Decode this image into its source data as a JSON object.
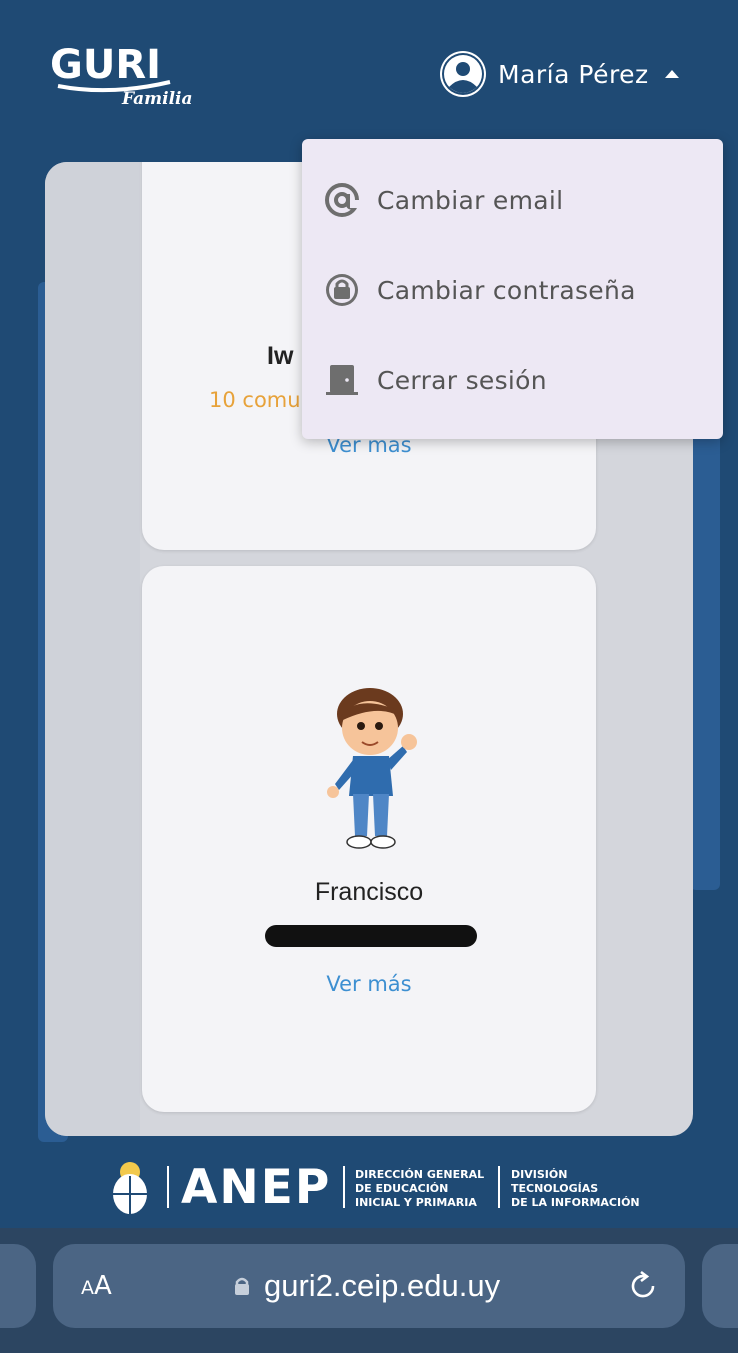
{
  "header": {
    "logo_text": "GURI",
    "logo_sub": "Familia",
    "user_name": "María Pérez"
  },
  "menu": {
    "items": [
      {
        "label": "Cambiar email",
        "icon": "at-icon"
      },
      {
        "label": "Cambiar contraseña",
        "icon": "lock-icon"
      },
      {
        "label": "Cerrar sesión",
        "icon": "door-icon"
      }
    ]
  },
  "cards": [
    {
      "name": "Iw",
      "communications": "10 comu",
      "link": "Ver más"
    },
    {
      "name": "Francisco",
      "link": "Ver más"
    }
  ],
  "footer": {
    "brand": "ANEP",
    "org1": "DIRECCIÓN GENERAL\nDE EDUCACIÓN\nINICIAL Y PRIMARIA",
    "org2": "DIVISIÓN\nTECNOLOGÍAS\nDE LA INFORMACIÓN"
  },
  "browser": {
    "aa_small": "A",
    "aa_large": "A",
    "url": "guri2.ceip.edu.uy"
  },
  "colors": {
    "background": "#1f4a74",
    "dropdown": "#ede8f4",
    "link": "#3d8fd1",
    "accent_orange": "#e7a23a"
  }
}
